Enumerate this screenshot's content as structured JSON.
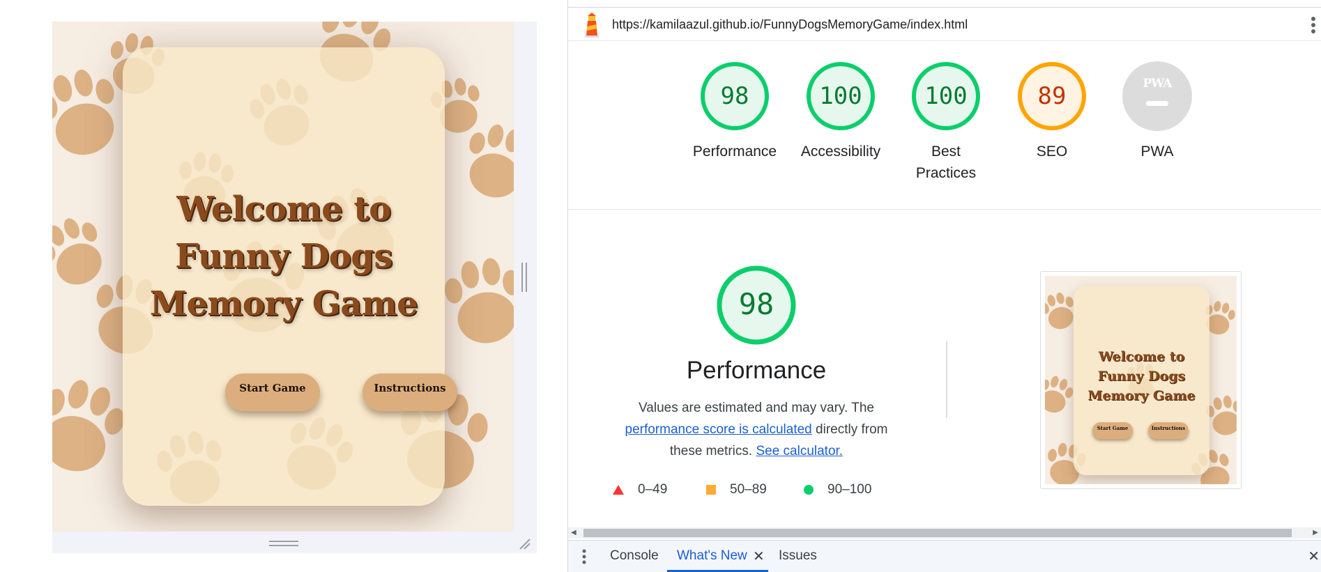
{
  "preview": {
    "title": "Welcome to Funny Dogs Memory Game",
    "buttons": {
      "start": "Start Game",
      "instructions": "Instructions"
    }
  },
  "devtools": {
    "url": "https://kamilaazul.github.io/FunnyDogsMemoryGame/index.html",
    "gauges": [
      {
        "label": "Performance",
        "score": "98",
        "status": "pass"
      },
      {
        "label": "Accessibility",
        "score": "100",
        "status": "pass"
      },
      {
        "label": "Best Practices",
        "score": "100",
        "status": "pass"
      },
      {
        "label": "SEO",
        "score": "89",
        "status": "average"
      },
      {
        "label": "PWA",
        "score": "",
        "badge": "PWA",
        "status": "na"
      }
    ],
    "performance": {
      "score": "98",
      "title": "Performance",
      "desc_prefix": "Values are estimated and may vary. The ",
      "link1": "performance score is calculated",
      "desc_middle": " directly from these metrics. ",
      "link2": "See calculator.",
      "legend": [
        {
          "shape": "triangle",
          "range": "0–49",
          "color": "#ff3333"
        },
        {
          "shape": "square",
          "range": "50–89",
          "color": "#ffaa33"
        },
        {
          "shape": "circle",
          "range": "90–100",
          "color": "#0cce6b"
        }
      ]
    },
    "drawer_tabs": {
      "console": "Console",
      "whats_new": "What's New",
      "issues": "Issues"
    }
  },
  "colors": {
    "pass": "#0cce6b",
    "pass_text": "#0a7a30",
    "average": "#ffa400",
    "average_text": "#c33300",
    "na": "#dcdcdc",
    "pass_fill": "#e6f8ee",
    "average_fill": "#fff3e3"
  },
  "icons": [
    "lighthouse-icon",
    "kebab-icon",
    "close-icon",
    "paw-print-background"
  ]
}
